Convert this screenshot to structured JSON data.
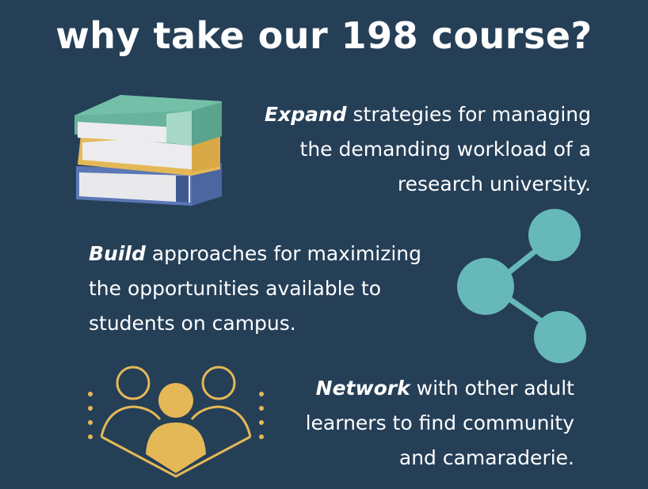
{
  "title": "why take our 198 course?",
  "blocks": [
    {
      "keyword": "Expand",
      "lines": [
        "strategies for managing",
        "the demanding workload of a",
        "research university."
      ]
    },
    {
      "keyword": "Build",
      "lines": [
        "approaches for maximizing",
        "the opportunities available to",
        "students on campus."
      ]
    },
    {
      "keyword": "Network",
      "lines": [
        "with other adult",
        "learners to find community",
        "and camaraderie."
      ]
    }
  ],
  "icons": {
    "books": "stack-of-books-icon",
    "share": "share-network-icon",
    "people": "group-of-people-icon"
  },
  "colors": {
    "background": "#253f57",
    "teal": "#66b9b8",
    "gold": "#e5b857",
    "text": "#ffffff"
  }
}
